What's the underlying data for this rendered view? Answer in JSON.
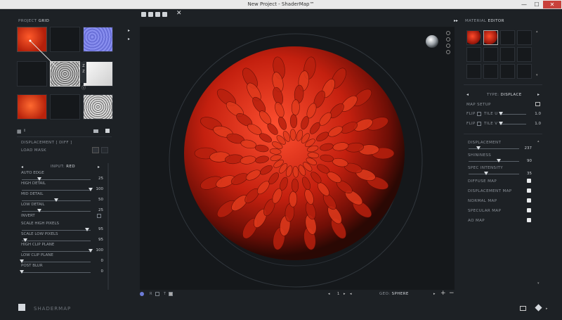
{
  "window": {
    "title": "New Project - ShaderMap™",
    "minimize": "—",
    "maximize": "☐",
    "close": "✕"
  },
  "left": {
    "header_prefix": "PROJECT",
    "header_bold": "GRID",
    "node_badges": [
      "Z",
      "Z"
    ],
    "panel_title": "DISPLACEMENT [ DIFF ]",
    "load_mask": "LOAD MASK",
    "input_prefix": "INPUT:",
    "input_value": "RED",
    "params": [
      {
        "label": "AUTO EDGE",
        "value": "25",
        "fraction": 0.25
      },
      {
        "label": "HIGH DETAIL",
        "value": "100",
        "fraction": 1.0
      },
      {
        "label": "MID DETAIL",
        "value": "50",
        "fraction": 0.5
      },
      {
        "label": "LOW DETAIL",
        "value": "25",
        "fraction": 0.25
      }
    ],
    "invert_label": "INVERT",
    "params2": [
      {
        "label": "SCALE HIGH PIXELS",
        "value": "95",
        "fraction": 0.95
      },
      {
        "label": "SCALE LOW PIXELS",
        "value": "95",
        "fraction": 0.05
      },
      {
        "label": "HIGH CLIP PLANE",
        "value": "100",
        "fraction": 1.0
      },
      {
        "label": "LOW CLIP PLANE",
        "value": "0",
        "fraction": 0.0
      },
      {
        "label": "POST BLUR",
        "value": "0",
        "fraction": 0.0
      }
    ]
  },
  "viewport": {
    "frame_value": "1",
    "geo_prefix": "GEO:",
    "geo_value": "SPHERE",
    "render_labels": [
      "R",
      "T"
    ]
  },
  "right": {
    "header_prefix": "MATERIAL",
    "header_bold": "EDITOR",
    "type_prefix": "TYPE:",
    "type_value": "DISPLACE",
    "map_setup": "MAP SETUP",
    "flip_rows": [
      {
        "flip": "FLIP",
        "tile": "TILE U",
        "value": "1.0",
        "fraction": 0.0
      },
      {
        "flip": "FLIP",
        "tile": "TILE V",
        "value": "1.0",
        "fraction": 0.0
      }
    ],
    "props": [
      {
        "label": "DISPLACEMENT",
        "value": "237",
        "fraction": 0.2
      },
      {
        "label": "SHININESS",
        "value": "90",
        "fraction": 0.6
      },
      {
        "label": "SPEC INTENSITY",
        "value": "35",
        "fraction": 0.35
      }
    ],
    "maps": [
      "DIFFUSE MAP",
      "DISPLACEMENT MAP",
      "NORMAL MAP",
      "SPECULAR MAP",
      "AO MAP"
    ]
  },
  "footer": {
    "brand": "SHADERMAP"
  },
  "colors": {
    "accent_red": "#c22a16",
    "normal_blue": "#7b82e8",
    "panel_bg": "#1d2125"
  }
}
